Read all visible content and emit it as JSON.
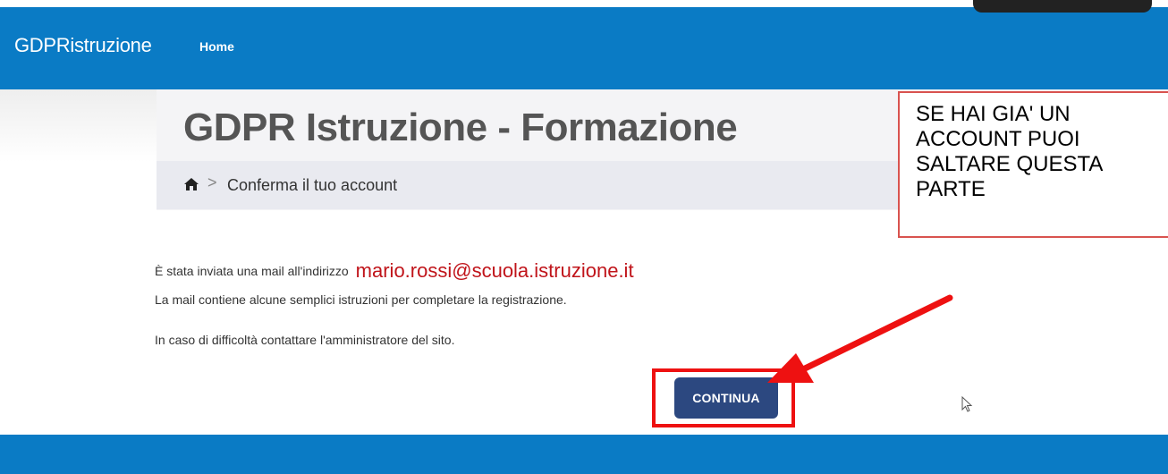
{
  "navbar": {
    "brand": "GDPRistruzione",
    "home_link": "Home"
  },
  "header": {
    "title": "GDPR Istruzione - Formazione",
    "breadcrumb": {
      "separator": ">",
      "current": "Conferma il tuo account"
    }
  },
  "note": {
    "lines": [
      "SE HAI GIA' UN",
      "ACCOUNT PUOI",
      "SALTARE QUESTA",
      "PARTE"
    ]
  },
  "main": {
    "sent_prefix": "È stata inviata una mail all'indirizzo",
    "email": "mario.rossi@scuola.istruzione.it",
    "instructions": "La mail contiene alcune semplici istruzioni per completare la registrazione.",
    "difficulty": "In caso di difficoltà contattare l'amministratore del sito.",
    "continue_label": "CONTINUA"
  },
  "colors": {
    "navbar": "#0a7bc5",
    "button": "#2c4880",
    "highlight": "#ee1111",
    "email": "#c0141a"
  },
  "icons": [
    "home-icon",
    "cursor-icon"
  ]
}
